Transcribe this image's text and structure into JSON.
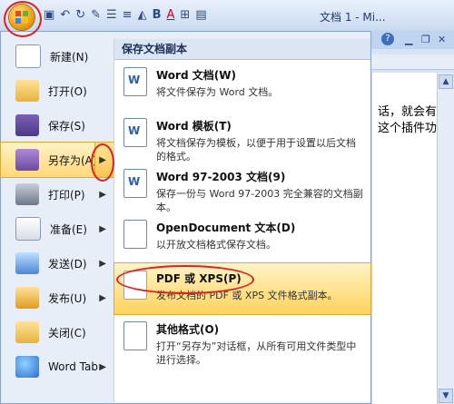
{
  "window": {
    "title": "文档 1 - Mi..."
  },
  "qat": {
    "items": [
      "save-icon",
      "undo-icon",
      "redo-icon",
      "format-painter-icon",
      "bullets-icon",
      "numbering-icon",
      "highlight-icon",
      "bold-icon",
      "font-color-icon",
      "borders-icon",
      "align-icon"
    ],
    "bold_label": "B",
    "font_color_label": "A"
  },
  "left_menu": [
    {
      "label": "新建(N)",
      "icon": "new-document-icon"
    },
    {
      "label": "打开(O)",
      "icon": "open-folder-icon"
    },
    {
      "label": "保存(S)",
      "icon": "save-icon"
    },
    {
      "label": "另存为(A)",
      "icon": "save-as-icon",
      "submenu": true,
      "highlighted": true
    },
    {
      "label": "打印(P)",
      "icon": "printer-icon",
      "submenu": true
    },
    {
      "label": "准备(E)",
      "icon": "prepare-icon",
      "submenu": true
    },
    {
      "label": "发送(D)",
      "icon": "send-icon",
      "submenu": true
    },
    {
      "label": "发布(U)",
      "icon": "publish-icon",
      "submenu": true
    },
    {
      "label": "关闭(C)",
      "icon": "close-folder-icon"
    },
    {
      "label": "Word Tab",
      "icon": "word-tab-icon",
      "submenu": true
    }
  ],
  "save_copy": {
    "header": "保存文档副本",
    "items": [
      {
        "title": "Word 文档(W)",
        "desc": "将文件保存为 Word 文档。",
        "icon": "word-document-icon"
      },
      {
        "title": "Word 模板(T)",
        "desc": "将文档保存为模板，以便于用于设置以后文档的格式。",
        "icon": "word-template-icon"
      },
      {
        "title": "Word 97-2003 文档(9)",
        "desc": "保存一份与 Word 97-2003 完全兼容的文档副本。",
        "icon": "word-97-document-icon"
      },
      {
        "title": "OpenDocument 文本(D)",
        "desc": "以开放文档格式保存文档。",
        "icon": "odt-document-icon"
      },
      {
        "title": "PDF 或 XPS(P)",
        "desc": "发布文档的 PDF 或 XPS 文件格式副本。",
        "icon": "pdf-xps-icon",
        "highlighted": true
      },
      {
        "title": "其他格式(O)",
        "desc": "打开“另存为”对话框，从所有可用文件类型中进行选择。",
        "icon": "other-formats-icon"
      }
    ]
  },
  "document": {
    "lines": [
      "话，就会有",
      "这个插件功能"
    ]
  },
  "colors": {
    "highlight": "#ffd877",
    "annotation": "#e02020",
    "menu_bg": "#e8eef8"
  }
}
